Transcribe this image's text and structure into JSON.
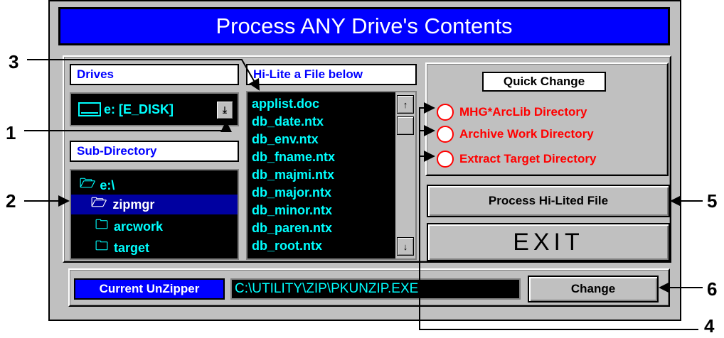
{
  "title": "Process ANY Drive's Contents",
  "drives": {
    "label": "Drives",
    "selected": "e: [E_DISK]"
  },
  "hilite_label": "Hi-Lite a File below",
  "subdir": {
    "label": "Sub-Directory",
    "items": [
      {
        "name": "e:\\",
        "icon": "open-folder-icon"
      },
      {
        "name": "zipmgr",
        "icon": "open-folder-icon"
      },
      {
        "name": "arcwork",
        "icon": "folder-icon"
      },
      {
        "name": "target",
        "icon": "folder-icon"
      }
    ],
    "selected": "zipmgr"
  },
  "files": [
    "applist.doc",
    "db_date.ntx",
    "db_env.ntx",
    "db_fname.ntx",
    "db_majmi.ntx",
    "db_major.ntx",
    "db_minor.ntx",
    "db_paren.ntx",
    "db_root.ntx"
  ],
  "quick_change": {
    "label": "Quick Change",
    "options": [
      "MHG*ArcLib Directory",
      "Archive Work Directory",
      "Extract Target Directory"
    ]
  },
  "buttons": {
    "process": "Process Hi-Lited File",
    "exit": "EXIT",
    "change": "Change"
  },
  "unzipper": {
    "label": "Current UnZipper",
    "path": "C:\\UTILITY\\ZIP\\PKUNZIP.EXE"
  },
  "callouts": [
    "1",
    "2",
    "3",
    "4",
    "5",
    "6"
  ],
  "colors": {
    "title_bar": "#0000ff",
    "list_text": "#00ffff",
    "radio_text": "#ff0000",
    "window": "#c0c0c0"
  }
}
